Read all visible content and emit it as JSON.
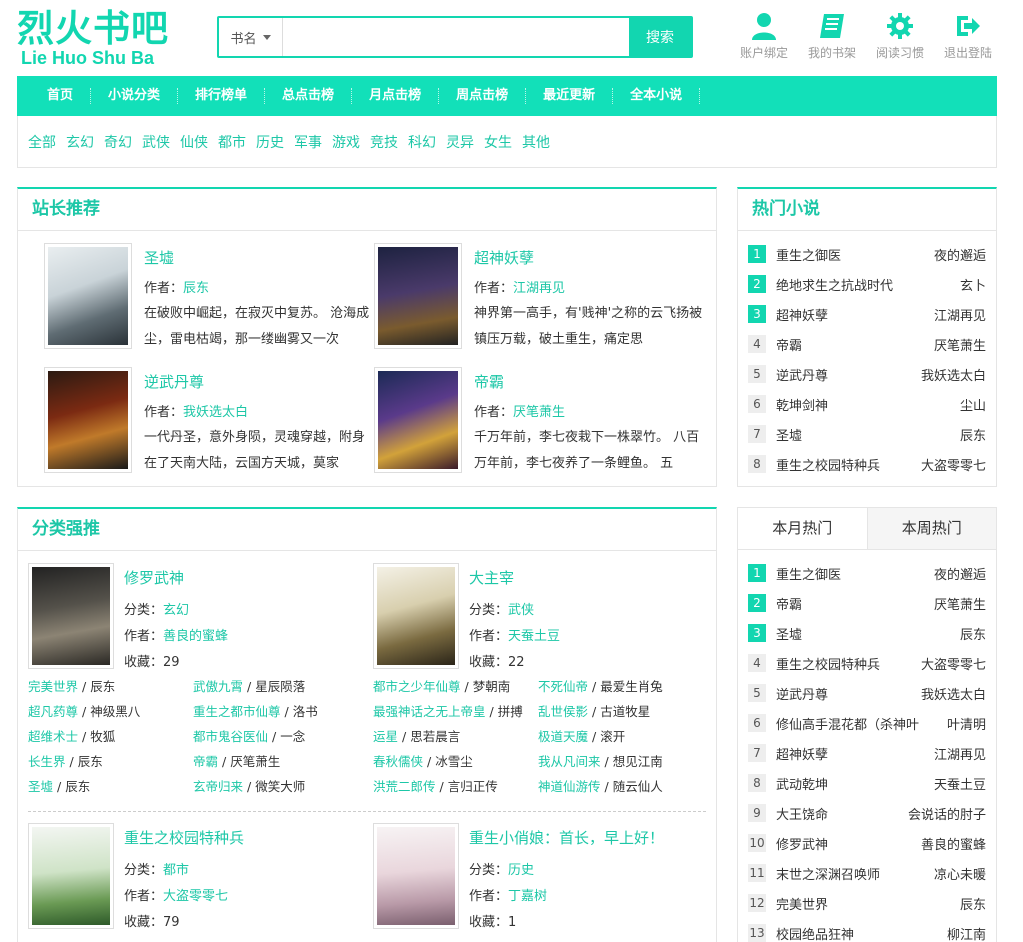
{
  "site": {
    "logo_cn": "烈火书吧",
    "logo_en": "Lie Huo Shu Ba"
  },
  "search": {
    "select_label": "书名",
    "placeholder": "",
    "button": "搜索"
  },
  "tools": [
    {
      "label": "账户绑定",
      "icon": "user-icon"
    },
    {
      "label": "我的书架",
      "icon": "book-icon"
    },
    {
      "label": "阅读习惯",
      "icon": "gear-icon"
    },
    {
      "label": "退出登陆",
      "icon": "logout-icon"
    }
  ],
  "nav": [
    "首页",
    "小说分类",
    "排行榜单",
    "总点击榜",
    "月点击榜",
    "周点击榜",
    "最近更新",
    "全本小说"
  ],
  "categories": [
    "全部",
    "玄幻",
    "奇幻",
    "武侠",
    "仙侠",
    "都市",
    "历史",
    "军事",
    "游戏",
    "竞技",
    "科幻",
    "灵异",
    "女生",
    "其他"
  ],
  "recommend": {
    "title": "站长推荐",
    "author_label": "作者：",
    "books": [
      {
        "title": "圣墟",
        "author": "辰东",
        "desc": "在破败中崛起，在寂灭中复苏。 沧海成尘，雷电枯竭，那一缕幽雾又一次"
      },
      {
        "title": "超神妖孽",
        "author": "江湖再见",
        "desc": "神界第一高手，有'贱神'之称的云飞扬被镇压万载，破土重生，痛定思"
      },
      {
        "title": "逆武丹尊",
        "author": "我妖选太白",
        "desc": "一代丹圣，意外身陨，灵魂穿越，附身在了天南大陆，云国方天城，莫家"
      },
      {
        "title": "帝霸",
        "author": "厌笔萧生",
        "desc": "千万年前，李七夜栽下一株翠竹。 八百万年前，李七夜养了一条鲤鱼。 五"
      }
    ]
  },
  "hot": {
    "title": "热门小说",
    "items": [
      {
        "rank": "1",
        "name": "重生之御医",
        "author": "夜的邂逅"
      },
      {
        "rank": "2",
        "name": "绝地求生之抗战时代",
        "author": "玄卜"
      },
      {
        "rank": "3",
        "name": "超神妖孽",
        "author": "江湖再见"
      },
      {
        "rank": "4",
        "name": "帝霸",
        "author": "厌笔萧生"
      },
      {
        "rank": "5",
        "name": "逆武丹尊",
        "author": "我妖选太白"
      },
      {
        "rank": "6",
        "name": "乾坤剑神",
        "author": "尘山"
      },
      {
        "rank": "7",
        "name": "圣墟",
        "author": "辰东"
      },
      {
        "rank": "8",
        "name": "重生之校园特种兵",
        "author": "大盗零零七"
      }
    ]
  },
  "classified": {
    "title": "分类强推",
    "category_label": "分类：",
    "author_label": "作者：",
    "fav_label": "收藏：",
    "blocks": [
      {
        "title": "修罗武神",
        "category": "玄幻",
        "author": "善良的蜜蜂",
        "favs": "29",
        "links": [
          [
            {
              "b": "完美世界",
              "a": "辰东"
            },
            {
              "b": "武傲九霄",
              "a": "星辰陨落"
            }
          ],
          [
            {
              "b": "超凡药尊",
              "a": "神级黑八"
            },
            {
              "b": "重生之都市仙尊",
              "a": "洛书"
            }
          ],
          [
            {
              "b": "超维术士",
              "a": "牧狐"
            },
            {
              "b": "都市鬼谷医仙",
              "a": "一念"
            }
          ],
          [
            {
              "b": "长生界",
              "a": "辰东"
            },
            {
              "b": "帝霸",
              "a": "厌笔萧生"
            }
          ],
          [
            {
              "b": "圣墟",
              "a": "辰东"
            },
            {
              "b": "玄帝归来",
              "a": "微笑大师"
            }
          ]
        ]
      },
      {
        "title": "大主宰",
        "category": "武侠",
        "author": "天蚕土豆",
        "favs": "22",
        "links": [
          [
            {
              "b": "都市之少年仙尊",
              "a": "梦朝南"
            },
            {
              "b": "不死仙帝",
              "a": "最爱生肖兔"
            }
          ],
          [
            {
              "b": "最强神话之无上帝皇",
              "a": "拼搏"
            },
            {
              "b": "乱世侯影",
              "a": "古道牧星"
            }
          ],
          [
            {
              "b": "运星",
              "a": "思若晨言"
            },
            {
              "b": "极道天魔",
              "a": "滚开"
            }
          ],
          [
            {
              "b": "春秋儒侠",
              "a": "冰雪尘"
            },
            {
              "b": "我从凡间来",
              "a": "想见江南"
            }
          ],
          [
            {
              "b": "洪荒二郎传",
              "a": "言归正传"
            },
            {
              "b": "神道仙游传",
              "a": "随云仙人"
            }
          ]
        ]
      },
      {
        "title": "重生之校园特种兵",
        "category": "都市",
        "author": "大盗零零七",
        "favs": "79"
      },
      {
        "title": "重生小俏娘：首长，早上好！",
        "category": "历史",
        "author": "丁嘉树",
        "favs": "1"
      }
    ]
  },
  "monthly": {
    "tab_month": "本月热门",
    "tab_week": "本周热门",
    "items": [
      {
        "rank": "1",
        "name": "重生之御医",
        "author": "夜的邂逅"
      },
      {
        "rank": "2",
        "name": "帝霸",
        "author": "厌笔萧生"
      },
      {
        "rank": "3",
        "name": "圣墟",
        "author": "辰东"
      },
      {
        "rank": "4",
        "name": "重生之校园特种兵",
        "author": "大盗零零七"
      },
      {
        "rank": "5",
        "name": "逆武丹尊",
        "author": "我妖选太白"
      },
      {
        "rank": "6",
        "name": "修仙高手混花都（杀神叶",
        "author": "叶清明"
      },
      {
        "rank": "7",
        "name": "超神妖孽",
        "author": "江湖再见"
      },
      {
        "rank": "8",
        "name": "武动乾坤",
        "author": "天蚕土豆"
      },
      {
        "rank": "9",
        "name": "大王饶命",
        "author": "会说话的肘子"
      },
      {
        "rank": "10",
        "name": "修罗武神",
        "author": "善良的蜜蜂"
      },
      {
        "rank": "11",
        "name": "末世之深渊召唤师",
        "author": "凉心未暖"
      },
      {
        "rank": "12",
        "name": "完美世界",
        "author": "辰东"
      },
      {
        "rank": "13",
        "name": "校园绝品狂神",
        "author": "柳江南"
      }
    ]
  },
  "colors": {
    "accent": "#12d6b0",
    "link": "#1dc7a7"
  }
}
